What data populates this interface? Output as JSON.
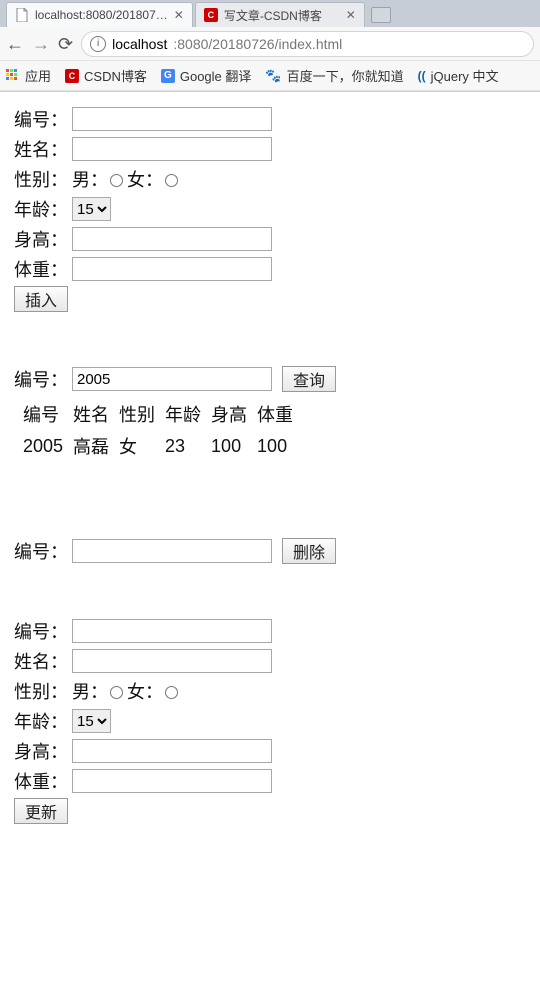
{
  "browser": {
    "tabs": [
      {
        "title": "localhost:8080/201807…",
        "favicon": "page"
      },
      {
        "title": "写文章-CSDN博客",
        "favicon": "csdn"
      }
    ],
    "url_host": "localhost",
    "url_port_path": ":8080/20180726/index.html",
    "bookmarks": {
      "apps": "应用",
      "csdn": "CSDN博客",
      "google": "Google 翻译",
      "baidu": "百度一下，你就知道",
      "jquery": "jQuery 中文"
    }
  },
  "labels": {
    "id": "编号：",
    "name": "姓名：",
    "gender": "性别：",
    "male": "男：",
    "female": "女：",
    "age": "年龄：",
    "height": "身高：",
    "weight": "体重：",
    "insert": "插入",
    "query": "查询",
    "delete": "删除",
    "update": "更新"
  },
  "insert_form": {
    "id": "",
    "name": "",
    "gender": null,
    "age": "15",
    "height": "",
    "weight": ""
  },
  "query_form": {
    "id": "2005"
  },
  "query_result": {
    "headers": [
      "编号",
      "姓名",
      "性别",
      "年龄",
      "身高",
      "体重"
    ],
    "row": {
      "id": "2005",
      "name": "高磊",
      "gender": "女",
      "age": "23",
      "height": "100",
      "weight": "100"
    }
  },
  "delete_form": {
    "id": ""
  },
  "update_form": {
    "id": "",
    "name": "",
    "gender": null,
    "age": "15",
    "height": "",
    "weight": ""
  }
}
